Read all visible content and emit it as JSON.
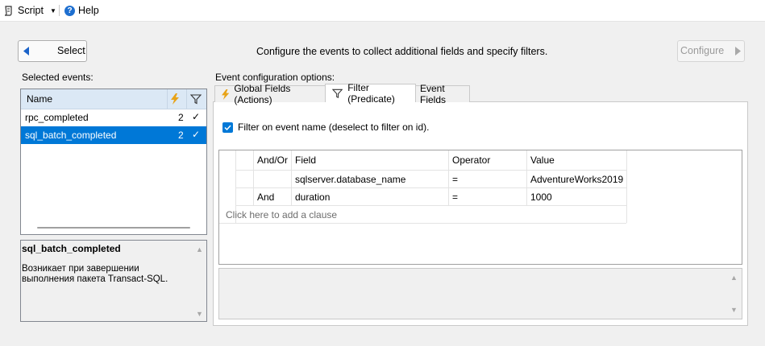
{
  "menubar": {
    "script_label": "Script",
    "help_label": "Help"
  },
  "toolbar": {
    "select_label": "Select",
    "instruction": "Configure the events to collect additional fields and specify filters.",
    "configure_label": "Configure"
  },
  "selected_events": {
    "title": "Selected events:",
    "header_name": "Name",
    "rows": [
      {
        "name": "rpc_completed",
        "count": "2",
        "check": "✓"
      },
      {
        "name": "sql_batch_completed",
        "count": "2",
        "check": "✓"
      }
    ]
  },
  "description": {
    "title": "sql_batch_completed",
    "text": "Возникает при завершении выполнения пакета Transact-SQL."
  },
  "config": {
    "title": "Event configuration options:",
    "tabs": [
      "Global Fields (Actions)",
      "Filter (Predicate)",
      "Event Fields"
    ],
    "filter_checkbox_label": "Filter on event name (deselect to filter on id).",
    "grid": {
      "headers": [
        "And/Or",
        "Field",
        "Operator",
        "Value"
      ],
      "rows": [
        {
          "andor": "",
          "field": "sqlserver.database_name",
          "operator": "=",
          "value": "AdventureWorks2019"
        },
        {
          "andor": "And",
          "field": "duration",
          "operator": "=",
          "value": "1000"
        }
      ],
      "add_clause": "Click here to add a clause"
    }
  },
  "colors": {
    "accent": "#0078d7",
    "header_blue": "#dbe8f5",
    "bolt": "#e8a317"
  }
}
